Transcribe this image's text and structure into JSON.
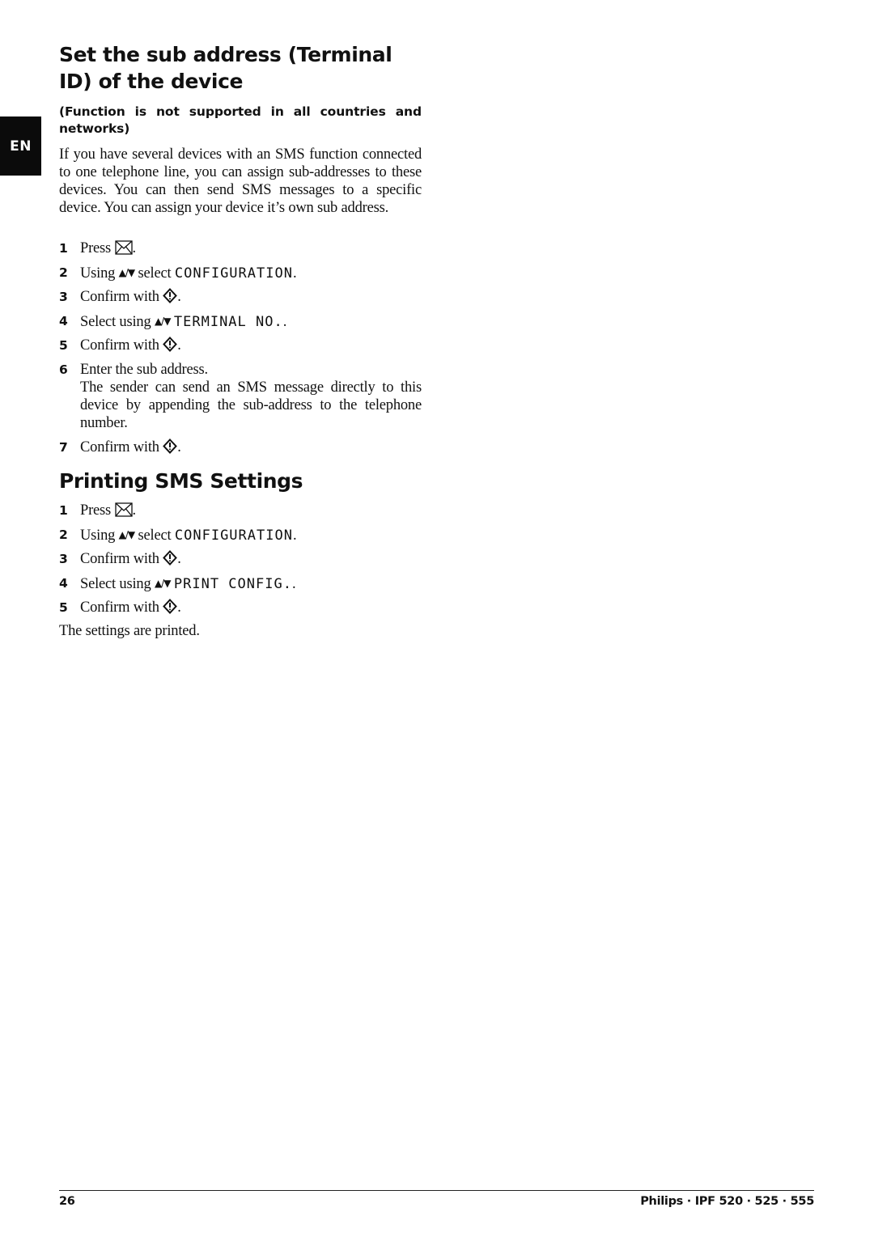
{
  "language_tab": "EN",
  "section1": {
    "title": "Set the sub address (Terminal ID) of the device",
    "note": "(Function is not supported in all countries and networks)",
    "intro": "If you have several devices with an SMS function connected to one telephone line, you can assign sub-addresses to these devices. You can then send SMS messages to a specific device. You can assign your  device it’s own sub address.",
    "steps": [
      {
        "num": "1",
        "pre": "Press ",
        "icon": "envelope-icon",
        "post": "."
      },
      {
        "num": "2",
        "pre": "Using ",
        "icon": "up-down-arrows-icon",
        "mid": " select ",
        "lcd": "CONFIGURATION",
        "post": "."
      },
      {
        "num": "3",
        "pre": "Confirm with ",
        "icon": "ok-diamond-icon",
        "post": "."
      },
      {
        "num": "4",
        "pre": "Select using ",
        "icon": "up-down-arrows-icon",
        "mid": " ",
        "lcd": "TERMINAL NO.",
        "post": "."
      },
      {
        "num": "5",
        "pre": "Confirm with ",
        "icon": "ok-diamond-icon",
        "post": "."
      },
      {
        "num": "6",
        "pre": "Enter the sub address.",
        "detail": "The sender can send an SMS message directly to this device by appending the sub-address to the telephone number."
      },
      {
        "num": "7",
        "pre": "Confirm with ",
        "icon": "ok-diamond-icon",
        "post": "."
      }
    ]
  },
  "section2": {
    "title": "Printing SMS Settings",
    "steps": [
      {
        "num": "1",
        "pre": "Press ",
        "icon": "envelope-icon",
        "post": "."
      },
      {
        "num": "2",
        "pre": "Using ",
        "icon": "up-down-arrows-icon",
        "mid": " select ",
        "lcd": "CONFIGURATION",
        "post": "."
      },
      {
        "num": "3",
        "pre": "Confirm with ",
        "icon": "ok-diamond-icon",
        "post": "."
      },
      {
        "num": "4",
        "pre": "Select using ",
        "icon": "up-down-arrows-icon",
        "mid": " ",
        "lcd": "PRINT CONFIG.",
        "post": "."
      },
      {
        "num": "5",
        "pre": "Confirm with ",
        "icon": "ok-diamond-icon",
        "post": "."
      }
    ],
    "result": "The settings are printed."
  },
  "footer": {
    "page_number": "26",
    "product": "Philips · IPF 520 · 525 · 555"
  },
  "icons": {
    "up_down_arrows": "▲/▼"
  }
}
